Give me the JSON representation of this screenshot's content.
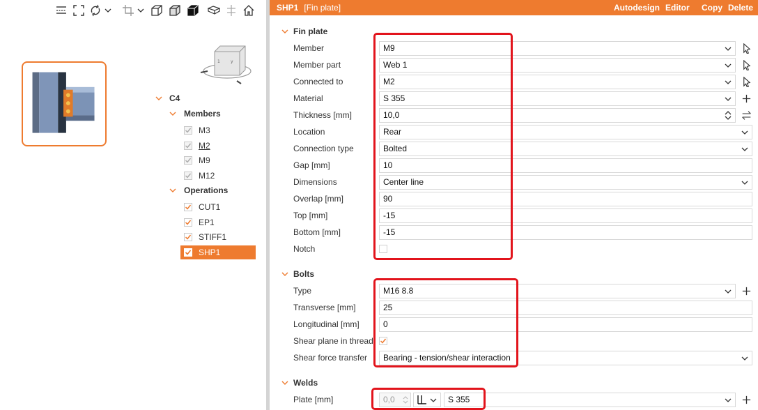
{
  "toolbar": {
    "icons": [
      "ruler-icon",
      "fit-view-icon",
      "rotate-icon",
      "chevron-down-icon",
      "crop-icon",
      "chevron-down-icon",
      "wireframe-cube-icon",
      "transparent-cube-icon",
      "solid-cube-icon",
      "plate-view-icon",
      "section-cut-icon",
      "home-icon"
    ]
  },
  "tree": {
    "root": "C4",
    "members_group": "Members",
    "members": [
      {
        "label": "M3"
      },
      {
        "label": "M2"
      },
      {
        "label": "M9"
      },
      {
        "label": "M12"
      }
    ],
    "operations_group": "Operations",
    "operations": [
      {
        "label": "CUT1"
      },
      {
        "label": "EP1"
      },
      {
        "label": "STIFF1"
      },
      {
        "label": "SHP1"
      }
    ]
  },
  "header": {
    "title": "SHP1",
    "subtitle": "[Fin plate]",
    "actions": {
      "autodesign": "Autodesign",
      "editor": "Editor",
      "copy": "Copy",
      "delete": "Delete"
    }
  },
  "fin_plate": {
    "section_title": "Fin plate",
    "rows": {
      "member": {
        "label": "Member",
        "value": "M9"
      },
      "member_part": {
        "label": "Member part",
        "value": "Web 1"
      },
      "connected_to": {
        "label": "Connected to",
        "value": "M2"
      },
      "material": {
        "label": "Material",
        "value": "S 355"
      },
      "thickness": {
        "label": "Thickness [mm]",
        "value": "10,0"
      },
      "location": {
        "label": "Location",
        "value": "Rear"
      },
      "connection_type": {
        "label": "Connection type",
        "value": "Bolted"
      },
      "gap": {
        "label": "Gap [mm]",
        "value": "10"
      },
      "dimensions": {
        "label": "Dimensions",
        "value": "Center line"
      },
      "overlap": {
        "label": "Overlap [mm]",
        "value": "90"
      },
      "top": {
        "label": "Top [mm]",
        "value": "-15"
      },
      "bottom": {
        "label": "Bottom [mm]",
        "value": "-15"
      },
      "notch": {
        "label": "Notch"
      }
    }
  },
  "bolts": {
    "section_title": "Bolts",
    "rows": {
      "type": {
        "label": "Type",
        "value": "M16 8.8"
      },
      "transverse": {
        "label": "Transverse [mm]",
        "value": "25"
      },
      "longitudinal": {
        "label": "Longitudinal [mm]",
        "value": "0"
      },
      "shear_plane": {
        "label": "Shear plane in thread"
      },
      "shear_force": {
        "label": "Shear force transfer",
        "value": "Bearing - tension/shear interaction"
      }
    }
  },
  "welds": {
    "section_title": "Welds",
    "plate": {
      "label": "Plate [mm]",
      "size": "0,0",
      "material": "S 355"
    }
  },
  "colors": {
    "accent": "#ee7b2f",
    "highlight": "#e2141c"
  }
}
